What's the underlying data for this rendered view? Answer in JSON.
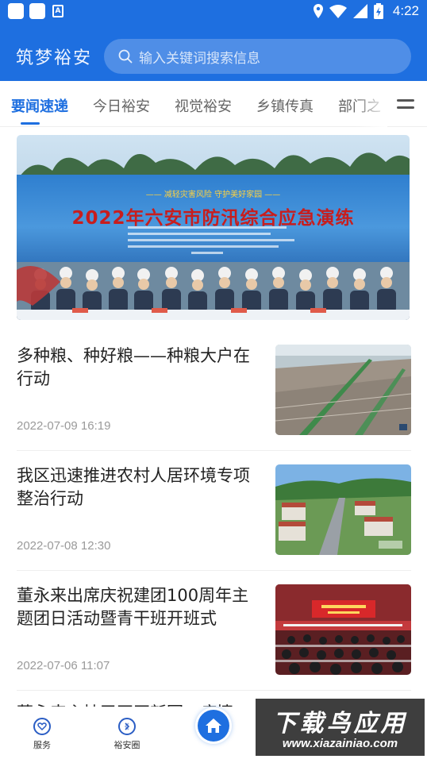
{
  "status_bar": {
    "time": "4:22",
    "battery": "4"
  },
  "header": {
    "app_name": "筑梦裕安",
    "search_placeholder": "输入关键词搜索信息"
  },
  "tabs": [
    {
      "label": "要闻速递",
      "active": true
    },
    {
      "label": "今日裕安",
      "active": false
    },
    {
      "label": "视觉裕安",
      "active": false
    },
    {
      "label": "乡镇传真",
      "active": false
    },
    {
      "label": "部门之",
      "active": false
    }
  ],
  "banner": {
    "subtitle": "—— 减轻灾害风险  守护美好家园 ——",
    "title": "2022年六安市防汛综合应急演练"
  },
  "news": [
    {
      "title": "多种粮、种好粮——种粮大户在行动",
      "date": "2022-07-09 16:19"
    },
    {
      "title": "我区迅速推进农村人居环境专项整治行动",
      "date": "2022-07-08 12:30"
    },
    {
      "title": "董永来出席庆祝建团100周年主题团日活动暨青干班开班式",
      "date": "2022-07-06 11:07"
    },
    {
      "title": "董永来主持召开区新冠…疫情"
    }
  ],
  "bottom_nav": [
    {
      "label": "服务"
    },
    {
      "label": "裕安圈"
    }
  ],
  "watermark": {
    "big": "下载鸟应用",
    "small": "www.xiazainiao.com"
  },
  "colors": {
    "brand": "#1e6fe0",
    "tab_active": "#1e6fe0",
    "date": "#9a9a9a"
  }
}
